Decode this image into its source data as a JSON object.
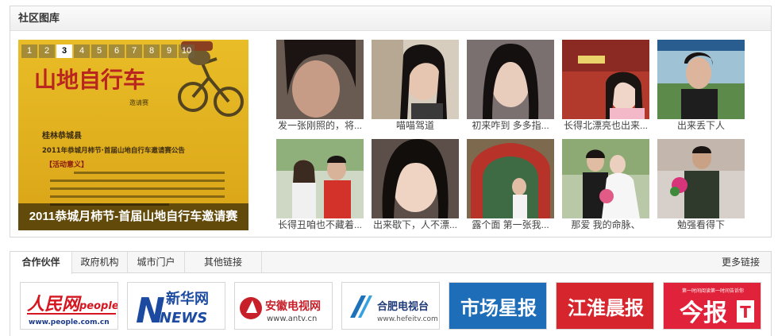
{
  "gallery": {
    "title": "社区图库",
    "slideshow": {
      "tabs": [
        "1",
        "2",
        "3",
        "4",
        "5",
        "6",
        "7",
        "8",
        "9",
        "10"
      ],
      "active_tab": "3",
      "caption": "2011恭城月柿节-首届山地自行车邀请赛",
      "poster": {
        "logo_text": "山地自行车",
        "logo_sub": "邀请赛",
        "county": "桂林恭城县",
        "headline": "2011年恭城月柿节·首届山地自行车邀请赛公告",
        "section": "【活动意义】"
      }
    },
    "thumbnails": [
      "发一张刚照的，将...",
      "喵喵驾道",
      "初来咋到 多多指...",
      "长得北漂亮也出来...",
      "出来丢下人",
      "长得丑咱也不藏着...",
      "出来歇下，人不漂...",
      "露个面 第一张我...",
      "那爱 我的命脉、",
      "勉强看得下"
    ]
  },
  "partners": {
    "tabs": [
      "合作伙伴",
      "政府机构",
      "城市门户",
      "其他链接"
    ],
    "active_tab": "合作伙伴",
    "more_label": "更多链接",
    "logos": {
      "people": {
        "name": "人民网",
        "brand": "people",
        "url": "www.people.com.cn"
      },
      "xinhua": {
        "name": "新华网",
        "brand": "NEWS"
      },
      "antv": {
        "name": "安徽电视网",
        "url": "www.antv.cn"
      },
      "hefeitv": {
        "name": "合肥电视台",
        "url": "www.hefeitv.com"
      },
      "market_star": {
        "name": "市场星报"
      },
      "jianghuai": {
        "name": "江淮晨报"
      },
      "jinbao": {
        "name": "今报",
        "tagline": "第一时间阅读第一时间告诉你"
      }
    }
  },
  "colors": {
    "poster_yellow": "#e2b21d",
    "poster_red": "#b8261f",
    "xinhua_blue": "#1c4aa0",
    "market_star_blue": "#1d6db8",
    "jianghuai_red": "#d6252c",
    "jinbao_red": "#e0223a"
  }
}
